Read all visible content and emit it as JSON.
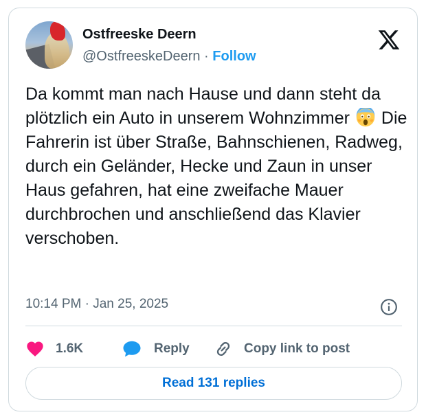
{
  "author": {
    "name": "Ostfreeske Deern",
    "handle": "@OstfreeskeDeern",
    "separator": "·",
    "follow_label": "Follow",
    "avatar": "avatar-photo"
  },
  "platform_logo": "x-logo-icon",
  "tweet": {
    "text_before_emoji": "Da kommt man nach Hause und dann steht da plötzlich ein Auto in unserem Wohnzimmer",
    "emoji": "😱",
    "text_after_emoji": "Die Fahrerin ist über Straße, Bahnschienen, Radweg, durch ein Geländer, Hecke und Zaun in unser Haus gefahren, hat eine zweifache Mauer durchbrochen und anschließend das Klavier verschoben.",
    "timestamp": "10:14 PM · Jan 25, 2025"
  },
  "actions": {
    "like_count": "1.6K",
    "reply_label": "Reply",
    "copy_link_label": "Copy link to post"
  },
  "read_replies_label": "Read 131 replies",
  "colors": {
    "accent": "#1d9bf0",
    "like": "#f91880",
    "muted": "#536471",
    "text": "#0f1419",
    "border": "#cfd9de"
  }
}
